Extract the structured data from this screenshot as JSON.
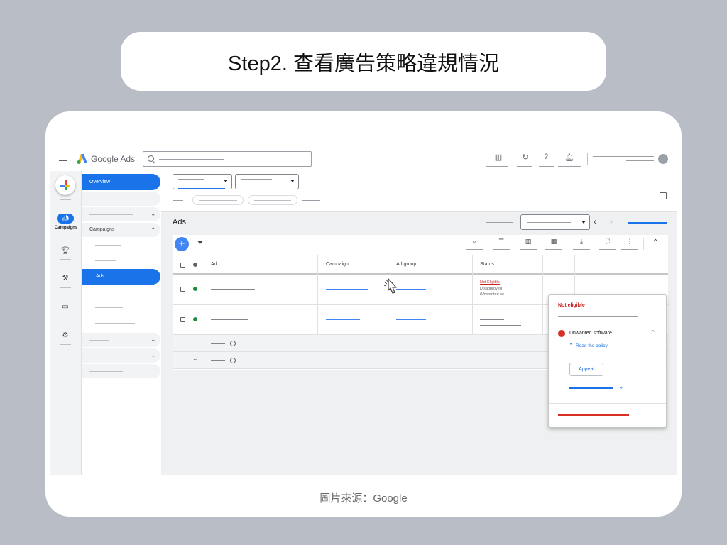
{
  "heading": "Step2. 查看廣告策略違規情況",
  "caption": "圖片來源：Google",
  "app": {
    "brand": "Google Ads",
    "rail": {
      "campaigns_label": "Campaigns"
    },
    "nav": {
      "overview": "Overview",
      "campaigns": "Campaigns",
      "ads": "Ads"
    },
    "main": {
      "title": "Ads"
    },
    "table": {
      "columns": [
        "Ad",
        "Campaign",
        "Ad group",
        "Status"
      ],
      "row1_status": {
        "line1": "Not Eligible",
        "line2": "Disapproved",
        "line3": "(Unwanted so"
      }
    },
    "popup": {
      "title": "Not eligible",
      "reason": "Unwanted software",
      "link": "Read the policy",
      "appeal": "Appeal"
    }
  },
  "icons": {
    "menu": "hamburger-icon",
    "search": "search-icon",
    "tools": [
      "building-icon",
      "refresh-icon",
      "help-icon",
      "bell-icon"
    ],
    "table_tools": [
      "search-icon",
      "segment-icon",
      "columns-icon",
      "reports-icon",
      "download-icon",
      "expand-icon",
      "more-icon"
    ]
  },
  "colors": {
    "accent": "#1a73e8",
    "error": "#c5221f",
    "enabled": "#1e8e3e",
    "background": "#b9bec6"
  }
}
